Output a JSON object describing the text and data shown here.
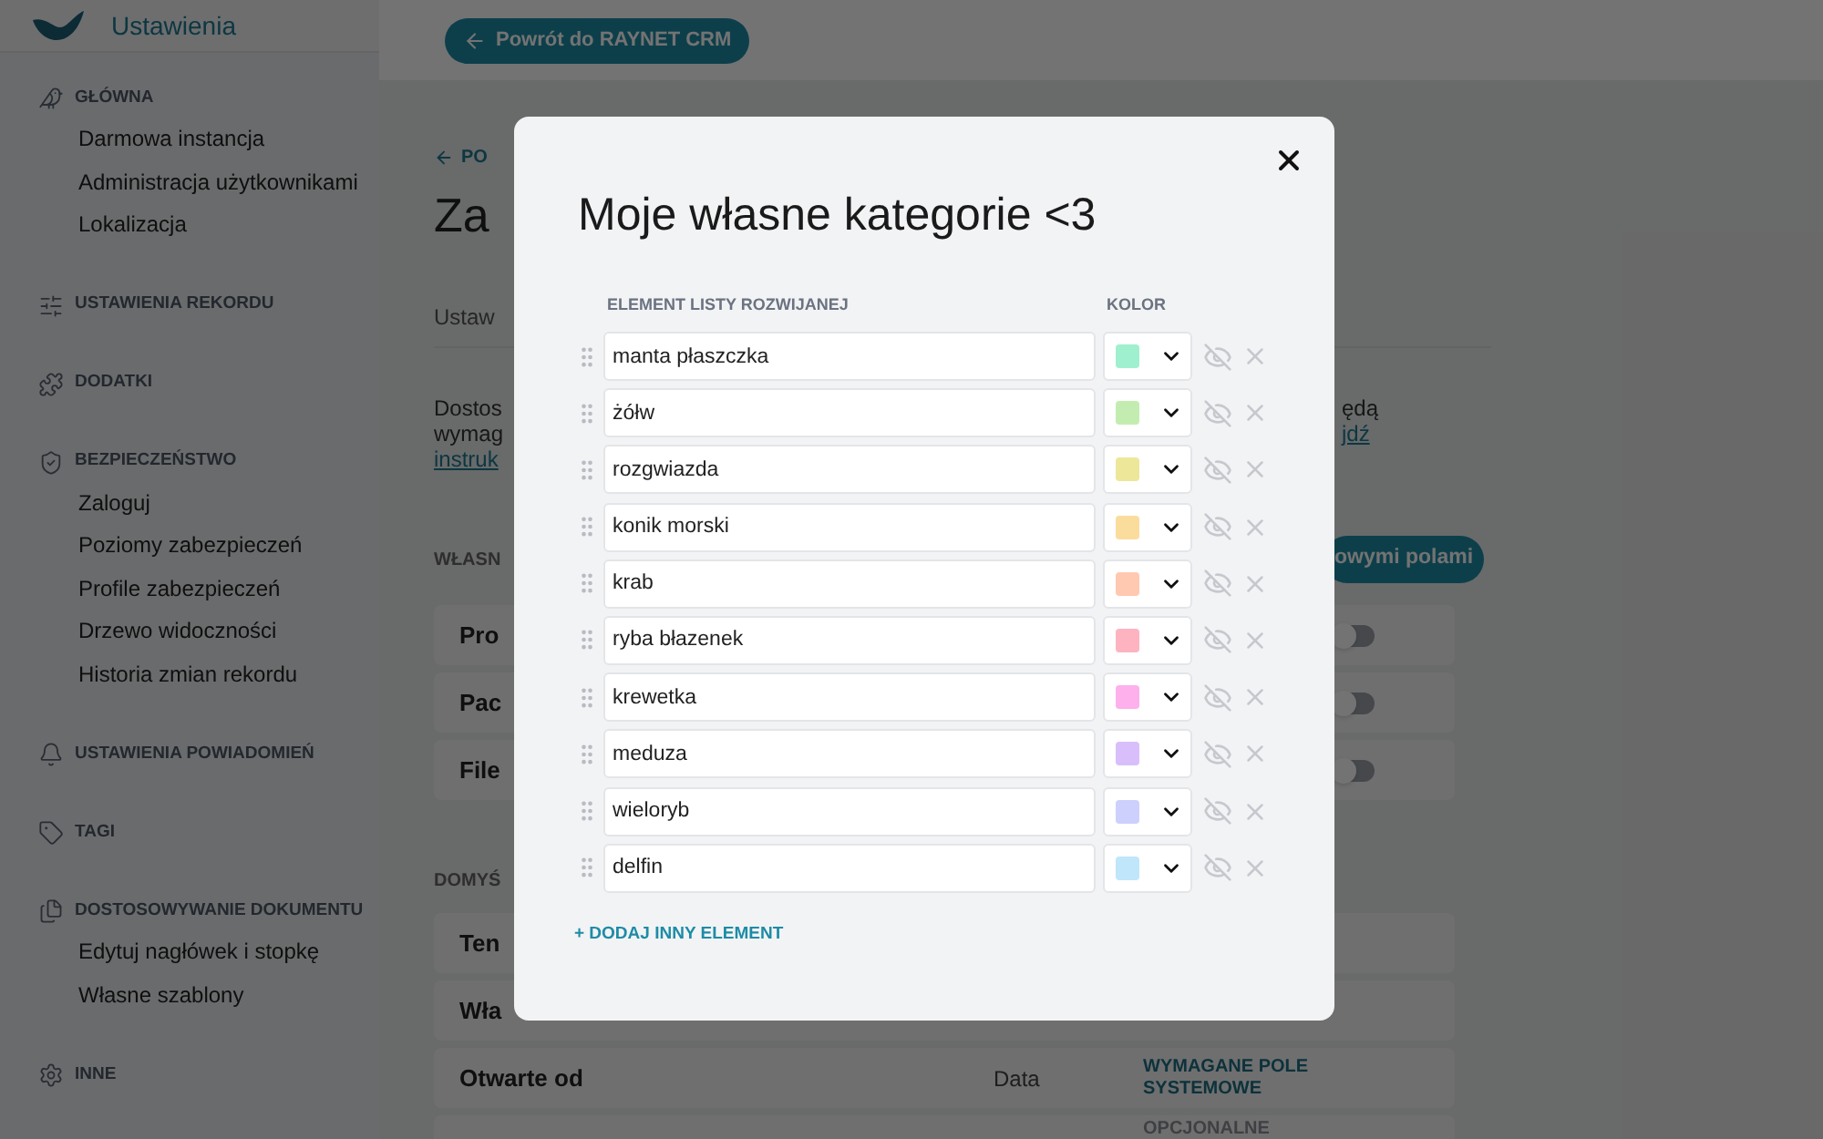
{
  "sidebar": {
    "title": "Ustawienia",
    "sections": [
      {
        "label": "GŁÓWNA",
        "items": [
          {
            "label": "Darmowa instancja"
          },
          {
            "label": "Administracja użytkownikami"
          },
          {
            "label": "Lokalizacja"
          }
        ]
      },
      {
        "label": "USTAWIENIA REKORDU"
      },
      {
        "label": "DODATKI"
      },
      {
        "label": "BEZPIECZEŃSTWO",
        "items": [
          {
            "label": "Zaloguj"
          },
          {
            "label": "Poziomy zabezpieczeń"
          },
          {
            "label": "Profile zabezpieczeń"
          },
          {
            "label": "Drzewo widoczności"
          },
          {
            "label": "Historia zmian rekordu"
          }
        ]
      },
      {
        "label": "USTAWIENIA POWIADOMIEŃ"
      },
      {
        "label": "TAGI"
      },
      {
        "label": "DOSTOSOWYWANIE DOKUMENTU",
        "items": [
          {
            "label": "Edytuj nagłówek i stopkę"
          },
          {
            "label": "Własne szablony"
          }
        ]
      },
      {
        "label": "INNE"
      }
    ]
  },
  "main": {
    "back_button": "Powrót do RAYNET CRM",
    "breadcrumb": "PO",
    "title": "Za",
    "tab": "Ustaw",
    "description": {
      "left_lines": [
        "Dostos",
        "wymag"
      ],
      "left_link": "instruk",
      "right_line": "ędą",
      "right_link": "jdź"
    },
    "custom_section": {
      "heading": "WŁASN",
      "button": "owymi polami",
      "rows": [
        {
          "label": "Pro",
          "on": false
        },
        {
          "label": "Pac",
          "on": false
        },
        {
          "label": "File",
          "on": false
        }
      ]
    },
    "default_section": {
      "heading": "DOMYŚ",
      "rows": [
        {
          "name": "Ten"
        },
        {
          "name": "Wła"
        },
        {
          "name": "Otwarte od",
          "type": "Data",
          "status": "WYMAGANE POLE SYSTEMOWE",
          "required": true
        },
        {
          "status": "OPCJONALNE",
          "required": false
        }
      ]
    }
  },
  "modal": {
    "title": "Moje własne kategorie <3",
    "columns": [
      "ELEMENT LISTY ROZWIJANEJ",
      "KOLOR"
    ],
    "items": [
      {
        "value": "manta płaszczka",
        "color": "#9ff0cf"
      },
      {
        "value": "żółw",
        "color": "#c3edb0"
      },
      {
        "value": "rozgwiazda",
        "color": "#ede79a"
      },
      {
        "value": "konik morski",
        "color": "#fadc9c"
      },
      {
        "value": "krab",
        "color": "#ffc9b1"
      },
      {
        "value": "ryba błazenek",
        "color": "#fdb3c0"
      },
      {
        "value": "krewetka",
        "color": "#fdb0ec"
      },
      {
        "value": "meduza",
        "color": "#d9befc"
      },
      {
        "value": "wieloryb",
        "color": "#cdd0fd"
      },
      {
        "value": "delfin",
        "color": "#bfe6fb"
      }
    ],
    "add_button": "+ DODAJ INNY ELEMENT"
  }
}
